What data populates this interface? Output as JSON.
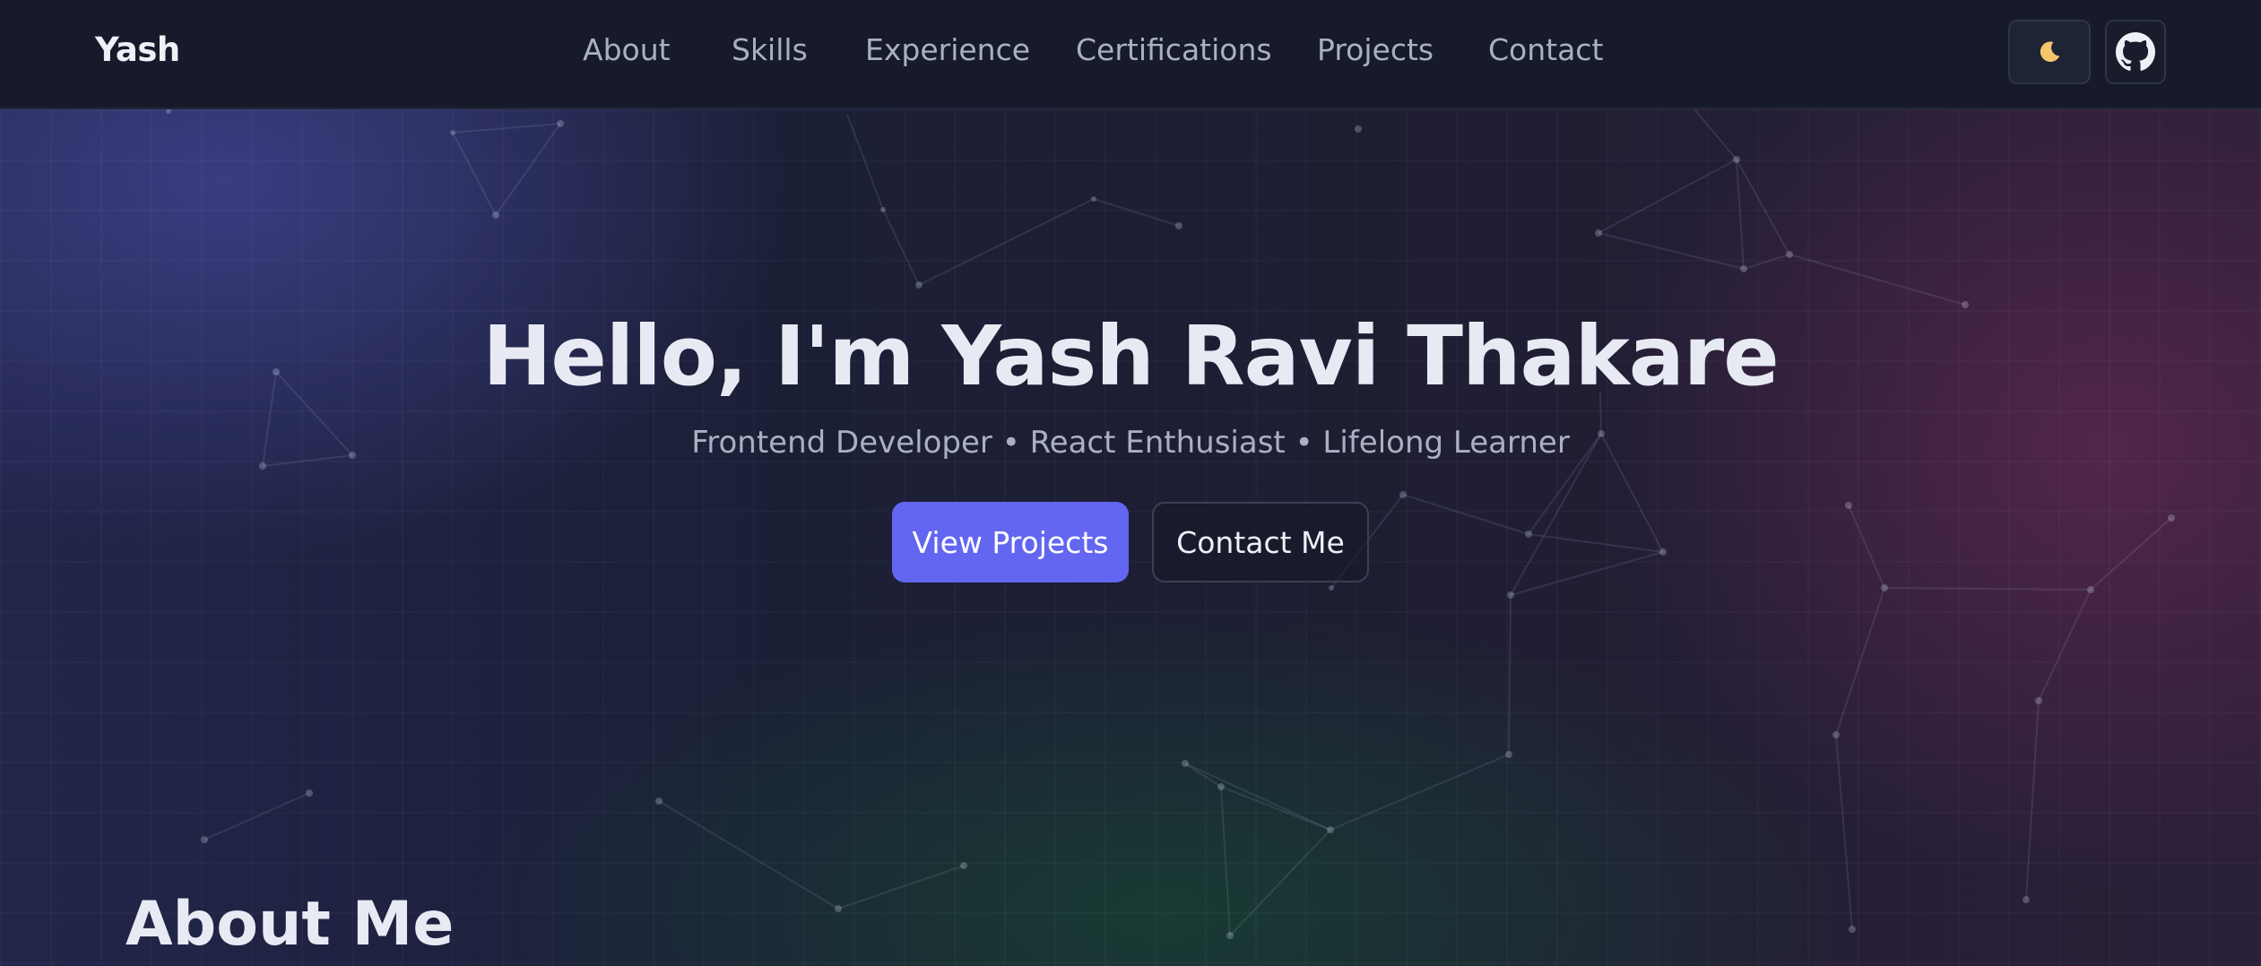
{
  "navbar": {
    "brand": "Yash",
    "links": [
      "About",
      "Skills",
      "Experience",
      "Certifications",
      "Projects",
      "Contact"
    ],
    "theme_icon": "moon-icon",
    "github_icon": "github-icon"
  },
  "hero": {
    "title": "Hello, I'm Yash Ravi Thakare",
    "subtitle": "Frontend Developer • React Enthusiast • Lifelong Learner",
    "primary_button": "View Projects",
    "secondary_button": "Contact Me"
  },
  "about": {
    "heading": "About Me"
  },
  "colors": {
    "accent": "#6366f1",
    "background": "#161a2b",
    "moon": "#f5c56b"
  }
}
